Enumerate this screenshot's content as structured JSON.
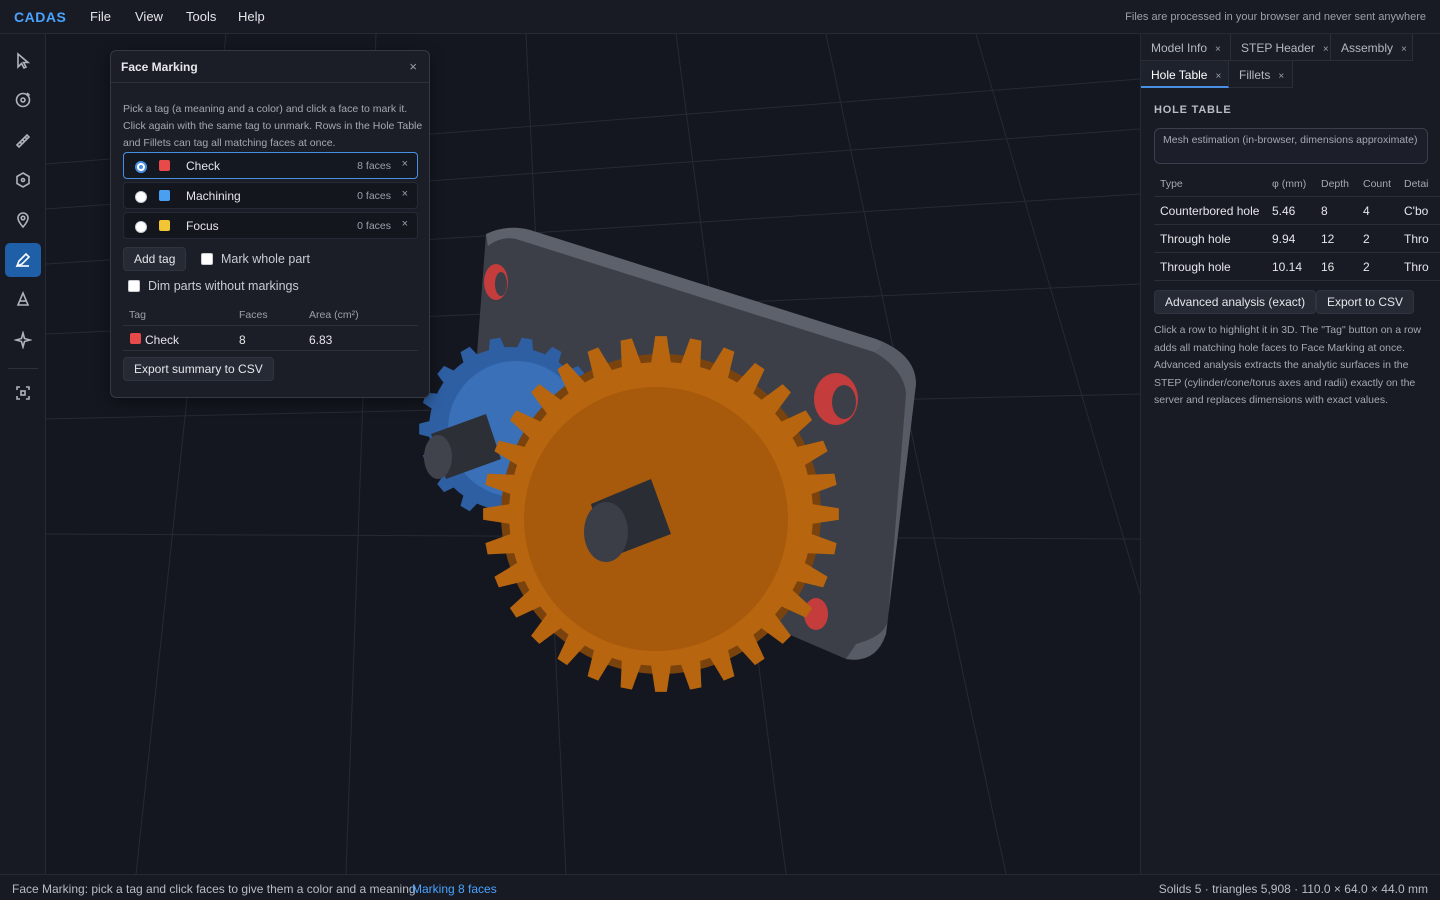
{
  "app": {
    "brand": "CADAS",
    "privacy_note": "Files are processed in your browser and never sent anywhere"
  },
  "menu": {
    "file": "File",
    "view": "View",
    "tools": "Tools",
    "help": "Help"
  },
  "toolbar": {
    "tools": [
      "cursor-icon",
      "orbit-icon",
      "ruler-icon",
      "section-icon",
      "pin-icon",
      "marker-icon",
      "cone-icon",
      "sparkle-icon",
      "fit-view-icon"
    ],
    "active_tool": "marker-icon"
  },
  "face_marking": {
    "title": "Face Marking",
    "close": "×",
    "description": "Pick a tag (a meaning and a color) and click a face to mark it. Click again with the same tag to unmark. Rows in the Hole Table and Fillets can tag all matching faces at once.",
    "tags": [
      {
        "name": "Check",
        "count": "8 faces",
        "color": "#e84a4a",
        "selected": true
      },
      {
        "name": "Machining",
        "count": "0 faces",
        "color": "#4a9ff0",
        "selected": false
      },
      {
        "name": "Focus",
        "count": "0 faces",
        "color": "#f2c534",
        "selected": false
      }
    ],
    "remove": "×",
    "add_tag": "Add tag",
    "mark_whole_part": "Mark whole part",
    "dim_parts": "Dim parts without markings",
    "summary": {
      "headers": {
        "tag": "Tag",
        "faces": "Faces",
        "area": "Area (cm²)"
      },
      "row": {
        "tag": "Check",
        "faces": "8",
        "area": "6.83",
        "color": "#e84a4a"
      }
    },
    "export_summary": "Export summary to CSV"
  },
  "right_panel": {
    "tabs": [
      {
        "label": "Model Info",
        "close": "×"
      },
      {
        "label": "STEP Header",
        "close": "×"
      },
      {
        "label": "Assembly",
        "close": "×"
      },
      {
        "label": "Hole Table",
        "close": "×"
      },
      {
        "label": "Fillets",
        "close": "×"
      }
    ],
    "active_tab": "Hole Table",
    "section_title": "HOLE TABLE",
    "estimate_note": "Mesh estimation (in-browser, dimensions approximate)",
    "columns": {
      "type": "Type",
      "diameter": "φ (mm)",
      "depth": "Depth",
      "count": "Count",
      "detail": "Detai"
    },
    "rows": [
      {
        "type": "Counterbored hole",
        "diameter": "5.46",
        "depth": "8",
        "count": "4",
        "detail": "C'bo"
      },
      {
        "type": "Through hole",
        "diameter": "9.94",
        "depth": "12",
        "count": "2",
        "detail": "Thro"
      },
      {
        "type": "Through hole",
        "diameter": "10.14",
        "depth": "16",
        "count": "2",
        "detail": "Thro"
      }
    ],
    "advanced_button": "Advanced analysis (exact)",
    "export_button": "Export to CSV",
    "help": "Click a row to highlight it in 3D. The \"Tag\" button on a row adds all matching hole faces to Face Marking at once. Advanced analysis extracts the analytic surfaces in the STEP (cylinder/cone/torus axes and radii) exactly on the server and replaces dimensions with exact values."
  },
  "status": {
    "hint": "Face Marking: pick a tag and click faces to give them a color and a meaning",
    "marking": "Marking 8 faces",
    "stats": "Solids 5 · triangles 5,908 · 110.0 × 64.0 × 44.0 mm"
  },
  "colors": {
    "accent": "#4a90e2",
    "gear_large": "#b8650f",
    "gear_small": "#2e5fa3",
    "plate": "#4b4f58",
    "marked": "#e84a4a"
  }
}
